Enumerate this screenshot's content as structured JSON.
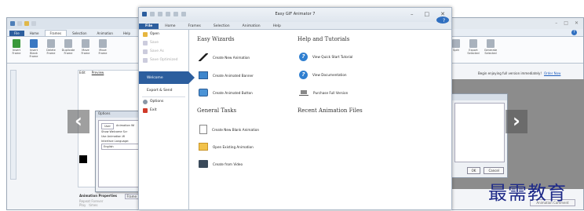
{
  "main": {
    "title": "Easy GIF Animator 7",
    "tabs": [
      "File",
      "Home",
      "Frames",
      "Selection",
      "Animation",
      "Help"
    ],
    "help_glyph": "?",
    "window_controls": [
      "–",
      "□",
      "✕"
    ],
    "sidebar": {
      "items_top": [
        {
          "label": "Open",
          "enabled": true,
          "icon": "open-folder-icon"
        },
        {
          "label": "Save",
          "enabled": false,
          "icon": "save-icon"
        },
        {
          "label": "Save As",
          "enabled": false,
          "icon": "save-as-icon"
        },
        {
          "label": "Save Optimized",
          "enabled": false,
          "icon": "save-optimized-icon"
        }
      ],
      "selected": "Welcome",
      "export": "Export & Send",
      "items_bottom": [
        {
          "label": "Options",
          "icon": "options-icon"
        },
        {
          "label": "Exit",
          "icon": "exit-icon"
        }
      ]
    },
    "easy_wizards": {
      "heading": "Easy Wizards",
      "items": [
        {
          "label": "Create New Animation",
          "icon": "magic-wand-icon"
        },
        {
          "label": "Create Animated Banner",
          "icon": "banner-icon"
        },
        {
          "label": "Create Animated Button",
          "icon": "button-icon"
        }
      ]
    },
    "help_tutorials": {
      "heading": "Help and Tutorials",
      "items": [
        {
          "label": "View Quick Start Tutorial",
          "icon": "question-circle-icon"
        },
        {
          "label": "View Documentation",
          "icon": "question-circle-icon"
        },
        {
          "label": "Purchase Full Version",
          "icon": "shopping-cart-icon"
        }
      ]
    },
    "general_tasks": {
      "heading": "General Tasks",
      "items": [
        {
          "label": "Create New Blank Animation",
          "icon": "blank-document-icon"
        },
        {
          "label": "Open Existing Animation",
          "icon": "folder-icon"
        },
        {
          "label": "Create from Video",
          "icon": "film-icon"
        }
      ]
    },
    "recent": {
      "heading": "Recent Animation Files"
    }
  },
  "left_window": {
    "tabs": [
      "File",
      "Home",
      "Frames",
      "Selection",
      "Animation",
      "Help"
    ],
    "ribbon": [
      "Insert Frame",
      "Insert Blank Frame",
      "Delete Frame",
      "Duplicate Frame",
      "Move Frame",
      "Move Frame"
    ],
    "ribbon_group": "Frame",
    "stage_tabs": [
      "Edit",
      "Preview"
    ],
    "options_dialog_title": "Options",
    "options_tabs": [
      "User",
      "Animation Wi"
    ],
    "options_lines": [
      "Show Welcome Scr",
      "Use Animation W",
      "Interface Language:",
      "English"
    ],
    "props_title": "Animation Properties",
    "props_tab": "Frame",
    "props_lines": [
      "Repeat Forever",
      "Play",
      "times"
    ]
  },
  "right_window": {
    "ribbon": [
      "Split",
      "Export Selected",
      "Generate Selected"
    ],
    "message": "Begin enjoying full version immediately!",
    "message_link": "Order Now",
    "dialog_buttons": [
      "OK",
      "Cancel"
    ],
    "bottom_button": "Animation Comment",
    "window_controls": [
      "–",
      "□",
      "✕"
    ]
  },
  "nav": {
    "prev": "‹",
    "next": "›"
  },
  "watermark": "最需教育",
  "colors": {
    "accent": "#2c5e9e",
    "help_blue": "#2f7fd0"
  }
}
